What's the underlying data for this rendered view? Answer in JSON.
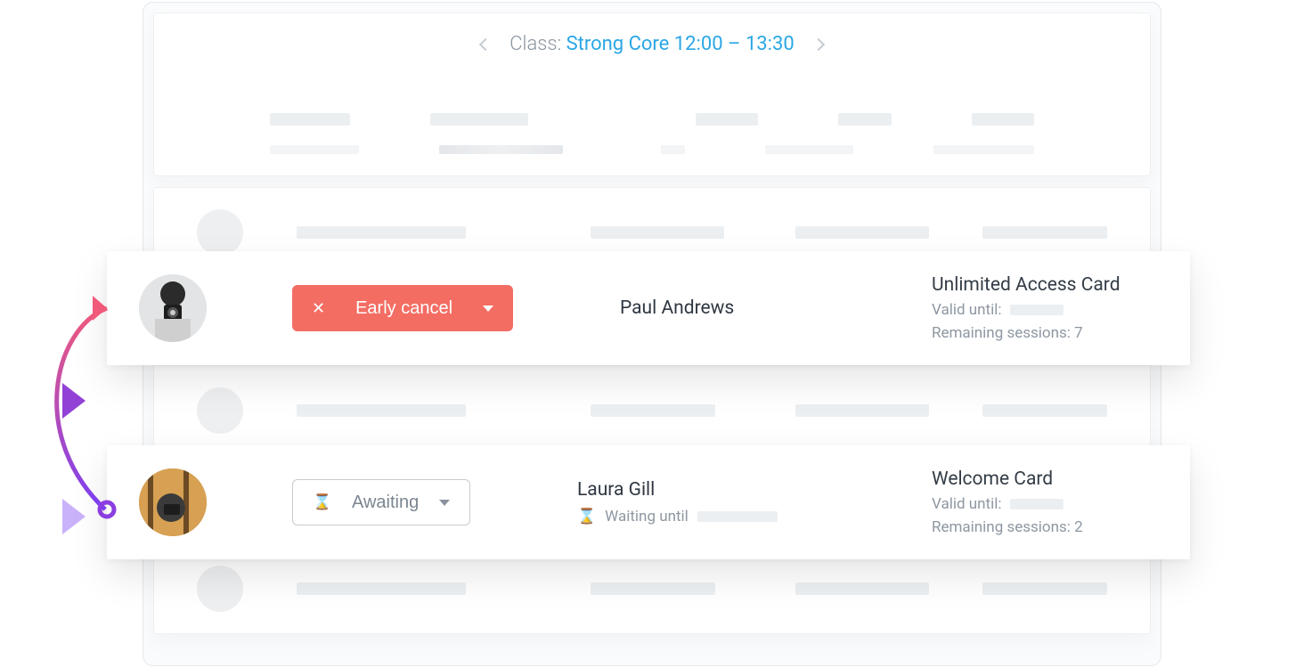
{
  "header": {
    "class_label": "Class: ",
    "class_name": "Strong Core 12:00 – 13:30"
  },
  "rows": [
    {
      "status_label": "Early cancel",
      "person_name": "Paul Andrews",
      "card_title": "Unlimited Access Card",
      "valid_until_label": "Valid until:",
      "remaining_label": "Remaining sessions: 7"
    },
    {
      "status_label": "Awaiting",
      "person_name": "Laura Gill",
      "waiting_label": "Waiting until",
      "card_title": "Welcome Card",
      "valid_until_label": "Valid until:",
      "remaining_label": "Remaining sessions: 2"
    }
  ]
}
